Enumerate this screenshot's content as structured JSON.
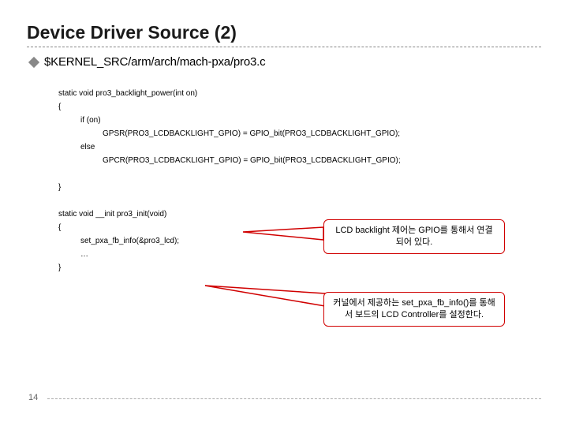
{
  "title": "Device Driver Source (2)",
  "source_path": "$KERNEL_SRC/arm/arch/mach-pxa/pro3.c",
  "code": {
    "l1": "static void pro3_backlight_power(int on)",
    "l2": "{",
    "l3": "if (on)",
    "l4": "GPSR(PRO3_LCDBACKLIGHT_GPIO) = GPIO_bit(PRO3_LCDBACKLIGHT_GPIO);",
    "l5": "else",
    "l6": "GPCR(PRO3_LCDBACKLIGHT_GPIO) = GPIO_bit(PRO3_LCDBACKLIGHT_GPIO);",
    "l7": "}",
    "l8": "static void __init pro3_init(void)",
    "l9": "{",
    "l10": "set_pxa_fb_info(&pro3_lcd);",
    "l11": "…",
    "l12": "}"
  },
  "callouts": {
    "c1": "LCD backlight 제어는 GPIO를 통해서 연결되어 있다.",
    "c2": "커널에서 제공하는 set_pxa_fb_info()를 통해서 보드의 LCD Controller를 설정한다."
  },
  "page_number": "14"
}
